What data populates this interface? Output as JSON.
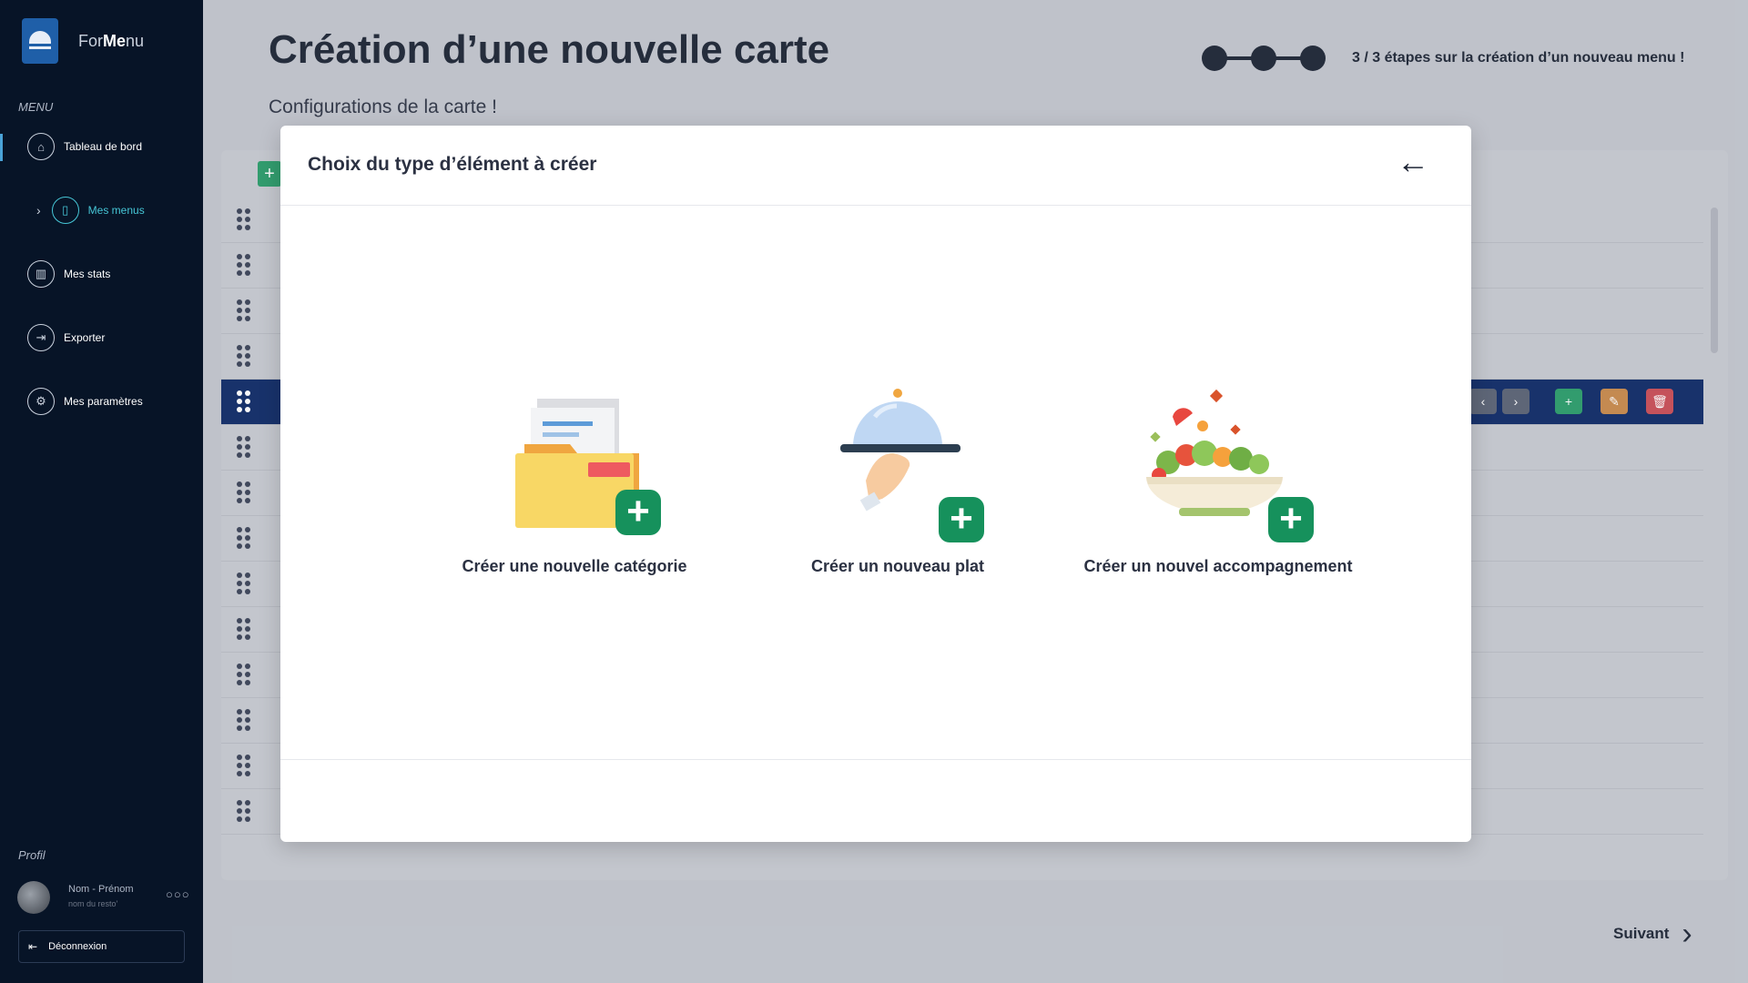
{
  "sidebar": {
    "logo": {
      "text_prefix": "For",
      "text_bold": "Me",
      "text_suffix": "nu"
    },
    "menu_title": "MENU",
    "items": [
      {
        "label": "Tableau de bord",
        "icon": "home-icon"
      },
      {
        "label": "Mes menus",
        "icon": "menu-book-icon"
      },
      {
        "label": "Mes stats",
        "icon": "bar-chart-icon"
      },
      {
        "label": "Exporter",
        "icon": "export-icon"
      },
      {
        "label": "Mes paramètres",
        "icon": "settings-icon"
      }
    ],
    "profil_title": "Profil",
    "profile": {
      "name": "Nom - Prénom",
      "resto": "nom du resto'"
    },
    "logout_label": "Déconnexion"
  },
  "main": {
    "title": "Création d’une nouvelle carte",
    "subtitle": "Configurations de la carte !",
    "stepper": {
      "current": 3,
      "total": 3,
      "text": "3 / 3 étapes sur la création d’un nouveau menu !"
    },
    "next_label": "Suivant"
  },
  "modal": {
    "title": "Choix du type d’élément à créer",
    "options": [
      {
        "label": "Créer une nouvelle catégorie",
        "icon": "folder-add-icon"
      },
      {
        "label": "Créer un nouveau plat",
        "icon": "cloche-add-icon"
      },
      {
        "label": "Créer un nouvel accompagnement",
        "icon": "salad-add-icon"
      }
    ]
  },
  "colors": {
    "sidebar_bg": "#071427",
    "accent_teal": "#46c6d6",
    "add_green": "#16915c",
    "edit_orange": "#c8894a",
    "delete_red": "#c94c55",
    "row_highlight": "#0e2a66"
  }
}
